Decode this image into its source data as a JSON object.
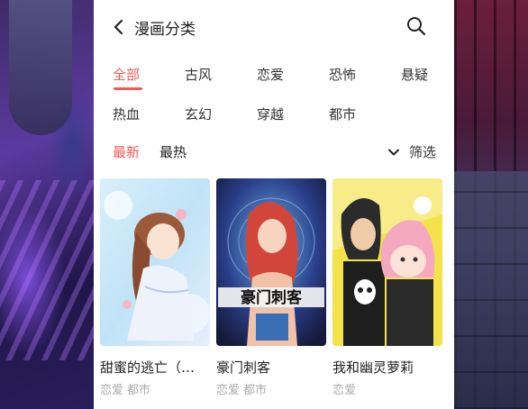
{
  "header": {
    "title": "漫画分类"
  },
  "genres": [
    {
      "label": "全部",
      "active": true
    },
    {
      "label": "古风",
      "active": false
    },
    {
      "label": "恋爱",
      "active": false
    },
    {
      "label": "恐怖",
      "active": false
    },
    {
      "label": "悬疑",
      "active": false
    },
    {
      "label": "热血",
      "active": false
    },
    {
      "label": "玄幻",
      "active": false
    },
    {
      "label": "穿越",
      "active": false
    },
    {
      "label": "都市",
      "active": false
    }
  ],
  "sort": {
    "options": [
      {
        "label": "最新",
        "active": true
      },
      {
        "label": "最热",
        "active": false
      }
    ],
    "filter_label": "筛选"
  },
  "comics": [
    {
      "title": "甜蜜的逃亡（…",
      "tags": [
        "恋爱",
        "都市"
      ],
      "cover_text": ""
    },
    {
      "title": "豪门刺客",
      "tags": [
        "恋爱",
        "都市"
      ],
      "cover_text": "豪门刺客"
    },
    {
      "title": "我和幽灵萝莉",
      "tags": [
        "恋爱"
      ],
      "cover_text": ""
    }
  ],
  "colors": {
    "accent": "#f05a52",
    "text": "#222222",
    "muted": "#aaaaaa"
  },
  "icons": {
    "back": "chevron-left-icon",
    "search": "search-icon",
    "filter": "chevron-down-icon"
  }
}
